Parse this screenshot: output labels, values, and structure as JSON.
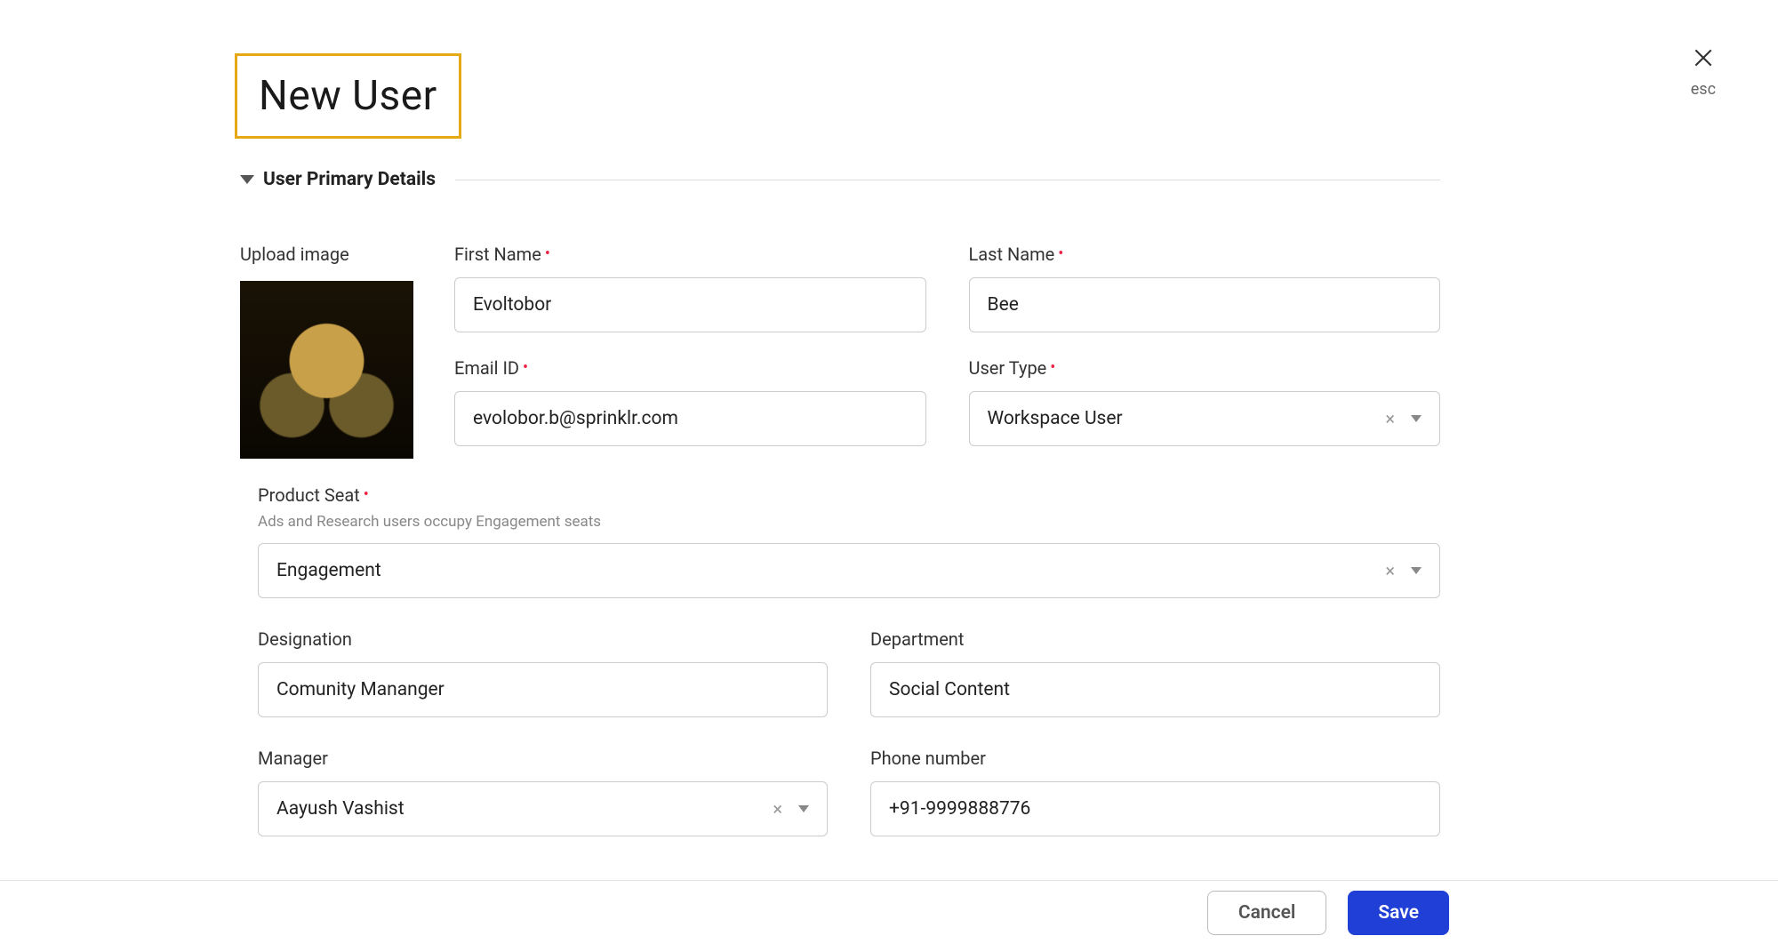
{
  "title": "New User",
  "close_label": "esc",
  "section_title": "User Primary Details",
  "fields": {
    "upload_image": {
      "label": "Upload image"
    },
    "first_name": {
      "label": "First Name",
      "value": "Evoltobor",
      "required": true
    },
    "last_name": {
      "label": "Last Name",
      "value": "Bee",
      "required": true
    },
    "email": {
      "label": "Email ID",
      "value": "evolobor.b@sprinklr.com",
      "required": true
    },
    "user_type": {
      "label": "User Type",
      "value": "Workspace User",
      "required": true
    },
    "product_seat": {
      "label": "Product Seat",
      "hint": "Ads and Research users occupy Engagement seats",
      "value": "Engagement",
      "required": true
    },
    "designation": {
      "label": "Designation",
      "value": "Comunity Mananger"
    },
    "department": {
      "label": "Department",
      "value": "Social Content"
    },
    "manager": {
      "label": "Manager",
      "value": "Aayush Vashist"
    },
    "phone": {
      "label": "Phone number",
      "value": "+91-9999888776"
    }
  },
  "buttons": {
    "cancel": "Cancel",
    "save": "Save"
  }
}
